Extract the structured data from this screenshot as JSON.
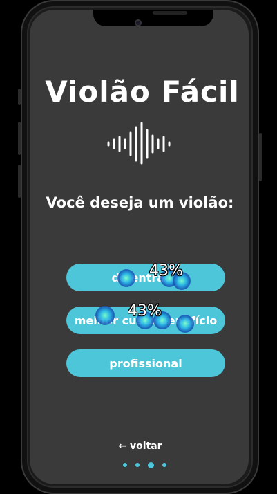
{
  "app": {
    "title": "Violão Fácil",
    "icon": "sound-wave-icon"
  },
  "question": "Você deseja um violão:",
  "options": [
    {
      "label": "de entrada",
      "click_share": "43%"
    },
    {
      "label": "melhor custo benefício",
      "click_share": "43%"
    },
    {
      "label": "profissional"
    }
  ],
  "nav": {
    "back_label": "← voltar"
  },
  "pagination": {
    "total": 4,
    "current": 3
  },
  "colors": {
    "accent": "#4cc6d8",
    "screen_bg": "#3a3a3a",
    "text": "#ffffff"
  }
}
